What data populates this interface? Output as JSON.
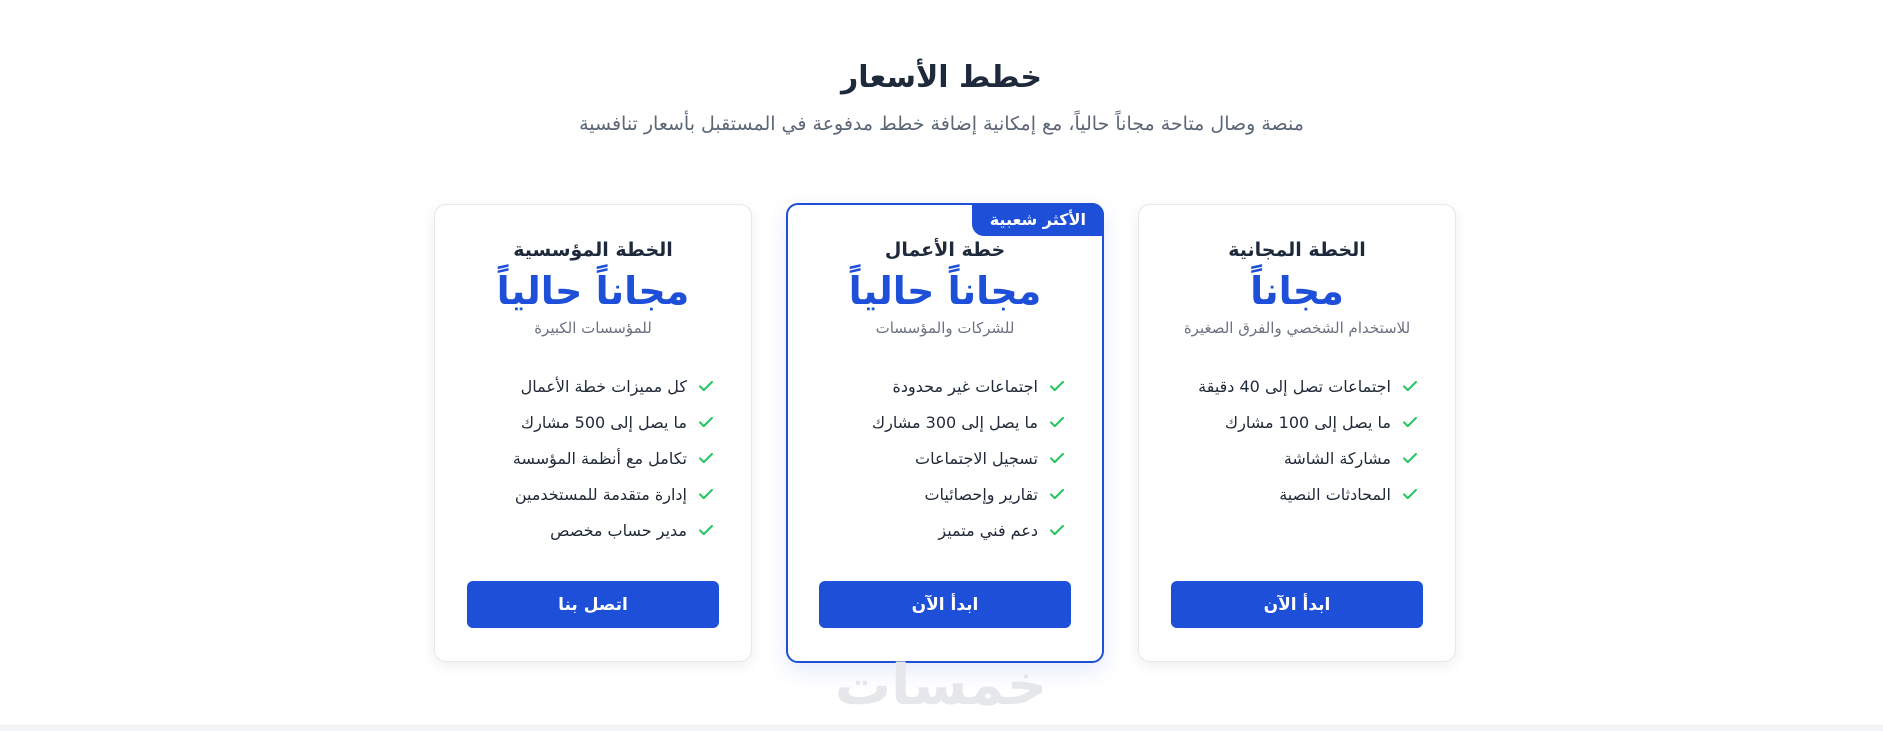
{
  "header": {
    "title": "خطط الأسعار",
    "subtitle": "منصة وصال متاحة مجاناً حالياً، مع إمكانية إضافة خطط مدفوعة في المستقبل بأسعار تنافسية"
  },
  "plans": {
    "free": {
      "name": "الخطة المجانية",
      "price": "مجاناً",
      "description": "للاستخدام الشخصي والفرق الصغيرة",
      "features": [
        "اجتماعات تصل إلى 40 دقيقة",
        "ما يصل إلى 100 مشارك",
        "مشاركة الشاشة",
        "المحادثات النصية"
      ],
      "button_label": "ابدأ الآن"
    },
    "business": {
      "badge": "الأكثر شعبية",
      "name": "خطة الأعمال",
      "price": "مجاناً حالياً",
      "description": "للشركات والمؤسسات",
      "features": [
        "اجتماعات غير محدودة",
        "ما يصل إلى 300 مشارك",
        "تسجيل الاجتماعات",
        "تقارير وإحصائيات",
        "دعم فني متميز"
      ],
      "button_label": "ابدأ الآن"
    },
    "enterprise": {
      "name": "الخطة المؤسسية",
      "price": "مجاناً حالياً",
      "description": "للمؤسسات الكبيرة",
      "features": [
        "كل مميزات خطة الأعمال",
        "ما يصل إلى 500 مشارك",
        "تكامل مع أنظمة المؤسسة",
        "إدارة متقدمة للمستخدمين",
        "مدير حساب مخصص"
      ],
      "button_label": "اتصل بنا"
    }
  },
  "watermark": "خمسات",
  "colors": {
    "accent": "#1d4fd8",
    "check": "#22c55e",
    "heading": "#1e2a3b",
    "muted": "#6b7280"
  },
  "icons": {
    "feature_marker": "check-icon"
  }
}
